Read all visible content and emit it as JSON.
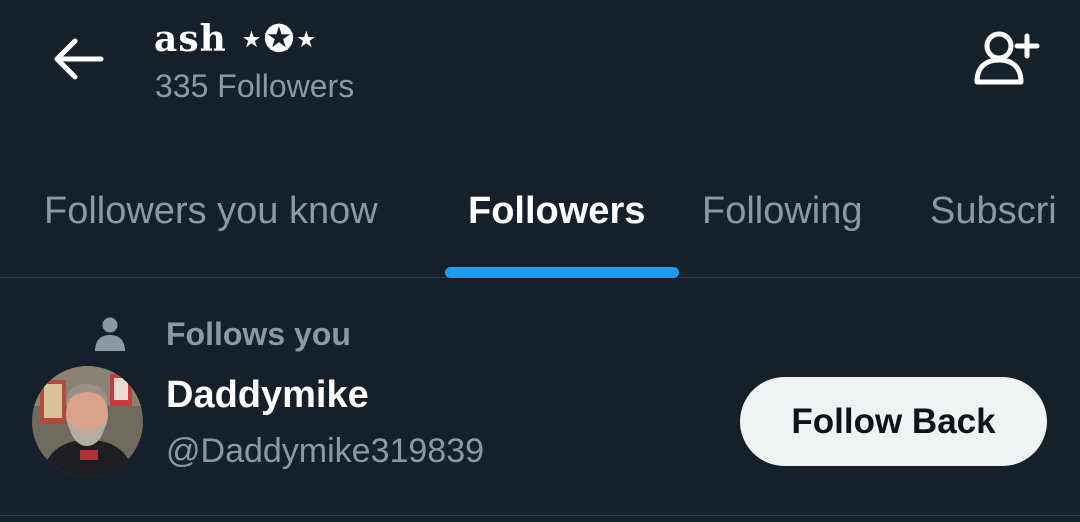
{
  "header": {
    "back_icon": "arrow-left-icon",
    "title": "ash ⋆✪⋆",
    "subtitle": "335 Followers",
    "add_user_icon": "add-user-icon"
  },
  "tabs": [
    {
      "label": "Followers you know",
      "active": false
    },
    {
      "label": "Followers",
      "active": true
    },
    {
      "label": "Following",
      "active": false
    },
    {
      "label": "Subscri",
      "active": false
    }
  ],
  "list": {
    "items": [
      {
        "context_icon": "person-icon",
        "context_label": "Follows you",
        "name": "Daddymike",
        "handle": "@Daddymike319839",
        "action_label": "Follow Back"
      }
    ]
  },
  "colors": {
    "background": "#16202b",
    "primary_text": "#ffffff",
    "secondary_text": "#8b98a5",
    "accent": "#1d9bf0",
    "button_bg": "#eff3f4",
    "button_text": "#0f1419"
  }
}
